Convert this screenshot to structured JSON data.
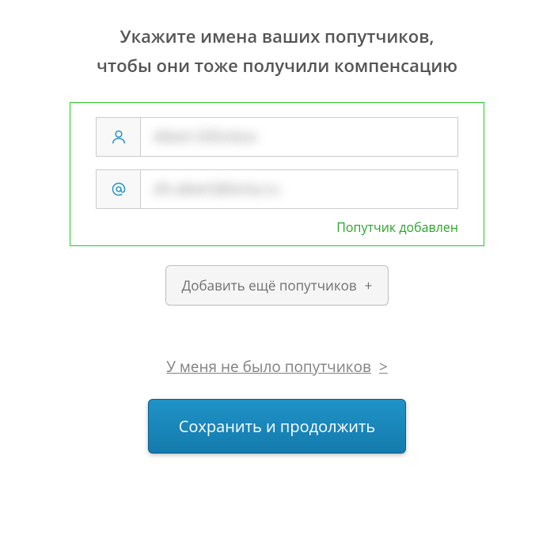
{
  "heading": {
    "line1": "Укажите имена ваших попутчиков,",
    "line2": "чтобы они тоже получили компенсацию"
  },
  "companion": {
    "name_value": "Albert Difonkov",
    "email_value": "dh-albert@lenta.ru",
    "status_text": "Попутчик добавлен"
  },
  "buttons": {
    "add_more": "Добавить ещё попутчиков",
    "add_more_plus": "+",
    "no_companions": "У меня не было попутчиков",
    "no_companions_chevron": ">",
    "submit": "Сохранить и продолжить"
  },
  "icons": {
    "person": "person-icon",
    "at": "at-icon"
  },
  "colors": {
    "accent_green": "#28c828",
    "primary_blue": "#147aad"
  }
}
